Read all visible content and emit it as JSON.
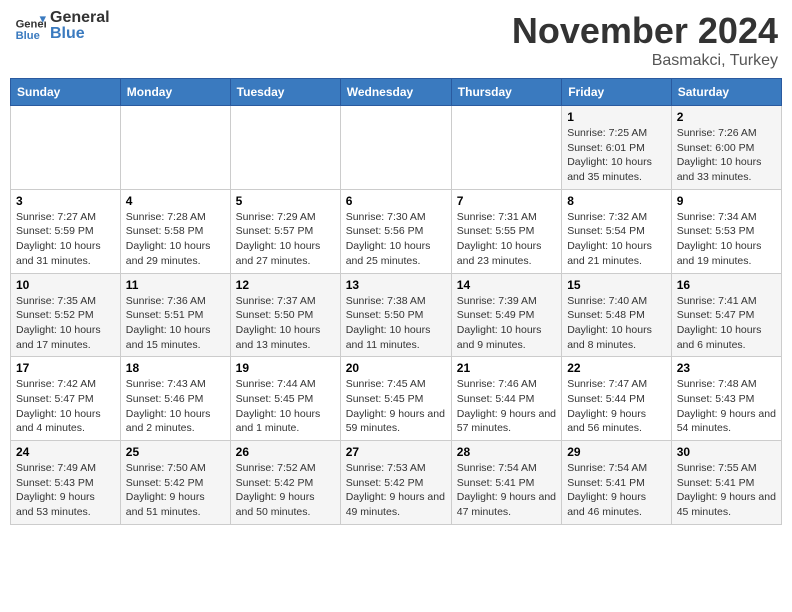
{
  "header": {
    "logo_general": "General",
    "logo_blue": "Blue",
    "month_title": "November 2024",
    "location": "Basmakci, Turkey"
  },
  "days_of_week": [
    "Sunday",
    "Monday",
    "Tuesday",
    "Wednesday",
    "Thursday",
    "Friday",
    "Saturday"
  ],
  "weeks": [
    [
      {
        "day": "",
        "info": ""
      },
      {
        "day": "",
        "info": ""
      },
      {
        "day": "",
        "info": ""
      },
      {
        "day": "",
        "info": ""
      },
      {
        "day": "",
        "info": ""
      },
      {
        "day": "1",
        "info": "Sunrise: 7:25 AM\nSunset: 6:01 PM\nDaylight: 10 hours and 35 minutes."
      },
      {
        "day": "2",
        "info": "Sunrise: 7:26 AM\nSunset: 6:00 PM\nDaylight: 10 hours and 33 minutes."
      }
    ],
    [
      {
        "day": "3",
        "info": "Sunrise: 7:27 AM\nSunset: 5:59 PM\nDaylight: 10 hours and 31 minutes."
      },
      {
        "day": "4",
        "info": "Sunrise: 7:28 AM\nSunset: 5:58 PM\nDaylight: 10 hours and 29 minutes."
      },
      {
        "day": "5",
        "info": "Sunrise: 7:29 AM\nSunset: 5:57 PM\nDaylight: 10 hours and 27 minutes."
      },
      {
        "day": "6",
        "info": "Sunrise: 7:30 AM\nSunset: 5:56 PM\nDaylight: 10 hours and 25 minutes."
      },
      {
        "day": "7",
        "info": "Sunrise: 7:31 AM\nSunset: 5:55 PM\nDaylight: 10 hours and 23 minutes."
      },
      {
        "day": "8",
        "info": "Sunrise: 7:32 AM\nSunset: 5:54 PM\nDaylight: 10 hours and 21 minutes."
      },
      {
        "day": "9",
        "info": "Sunrise: 7:34 AM\nSunset: 5:53 PM\nDaylight: 10 hours and 19 minutes."
      }
    ],
    [
      {
        "day": "10",
        "info": "Sunrise: 7:35 AM\nSunset: 5:52 PM\nDaylight: 10 hours and 17 minutes."
      },
      {
        "day": "11",
        "info": "Sunrise: 7:36 AM\nSunset: 5:51 PM\nDaylight: 10 hours and 15 minutes."
      },
      {
        "day": "12",
        "info": "Sunrise: 7:37 AM\nSunset: 5:50 PM\nDaylight: 10 hours and 13 minutes."
      },
      {
        "day": "13",
        "info": "Sunrise: 7:38 AM\nSunset: 5:50 PM\nDaylight: 10 hours and 11 minutes."
      },
      {
        "day": "14",
        "info": "Sunrise: 7:39 AM\nSunset: 5:49 PM\nDaylight: 10 hours and 9 minutes."
      },
      {
        "day": "15",
        "info": "Sunrise: 7:40 AM\nSunset: 5:48 PM\nDaylight: 10 hours and 8 minutes."
      },
      {
        "day": "16",
        "info": "Sunrise: 7:41 AM\nSunset: 5:47 PM\nDaylight: 10 hours and 6 minutes."
      }
    ],
    [
      {
        "day": "17",
        "info": "Sunrise: 7:42 AM\nSunset: 5:47 PM\nDaylight: 10 hours and 4 minutes."
      },
      {
        "day": "18",
        "info": "Sunrise: 7:43 AM\nSunset: 5:46 PM\nDaylight: 10 hours and 2 minutes."
      },
      {
        "day": "19",
        "info": "Sunrise: 7:44 AM\nSunset: 5:45 PM\nDaylight: 10 hours and 1 minute."
      },
      {
        "day": "20",
        "info": "Sunrise: 7:45 AM\nSunset: 5:45 PM\nDaylight: 9 hours and 59 minutes."
      },
      {
        "day": "21",
        "info": "Sunrise: 7:46 AM\nSunset: 5:44 PM\nDaylight: 9 hours and 57 minutes."
      },
      {
        "day": "22",
        "info": "Sunrise: 7:47 AM\nSunset: 5:44 PM\nDaylight: 9 hours and 56 minutes."
      },
      {
        "day": "23",
        "info": "Sunrise: 7:48 AM\nSunset: 5:43 PM\nDaylight: 9 hours and 54 minutes."
      }
    ],
    [
      {
        "day": "24",
        "info": "Sunrise: 7:49 AM\nSunset: 5:43 PM\nDaylight: 9 hours and 53 minutes."
      },
      {
        "day": "25",
        "info": "Sunrise: 7:50 AM\nSunset: 5:42 PM\nDaylight: 9 hours and 51 minutes."
      },
      {
        "day": "26",
        "info": "Sunrise: 7:52 AM\nSunset: 5:42 PM\nDaylight: 9 hours and 50 minutes."
      },
      {
        "day": "27",
        "info": "Sunrise: 7:53 AM\nSunset: 5:42 PM\nDaylight: 9 hours and 49 minutes."
      },
      {
        "day": "28",
        "info": "Sunrise: 7:54 AM\nSunset: 5:41 PM\nDaylight: 9 hours and 47 minutes."
      },
      {
        "day": "29",
        "info": "Sunrise: 7:54 AM\nSunset: 5:41 PM\nDaylight: 9 hours and 46 minutes."
      },
      {
        "day": "30",
        "info": "Sunrise: 7:55 AM\nSunset: 5:41 PM\nDaylight: 9 hours and 45 minutes."
      }
    ]
  ]
}
